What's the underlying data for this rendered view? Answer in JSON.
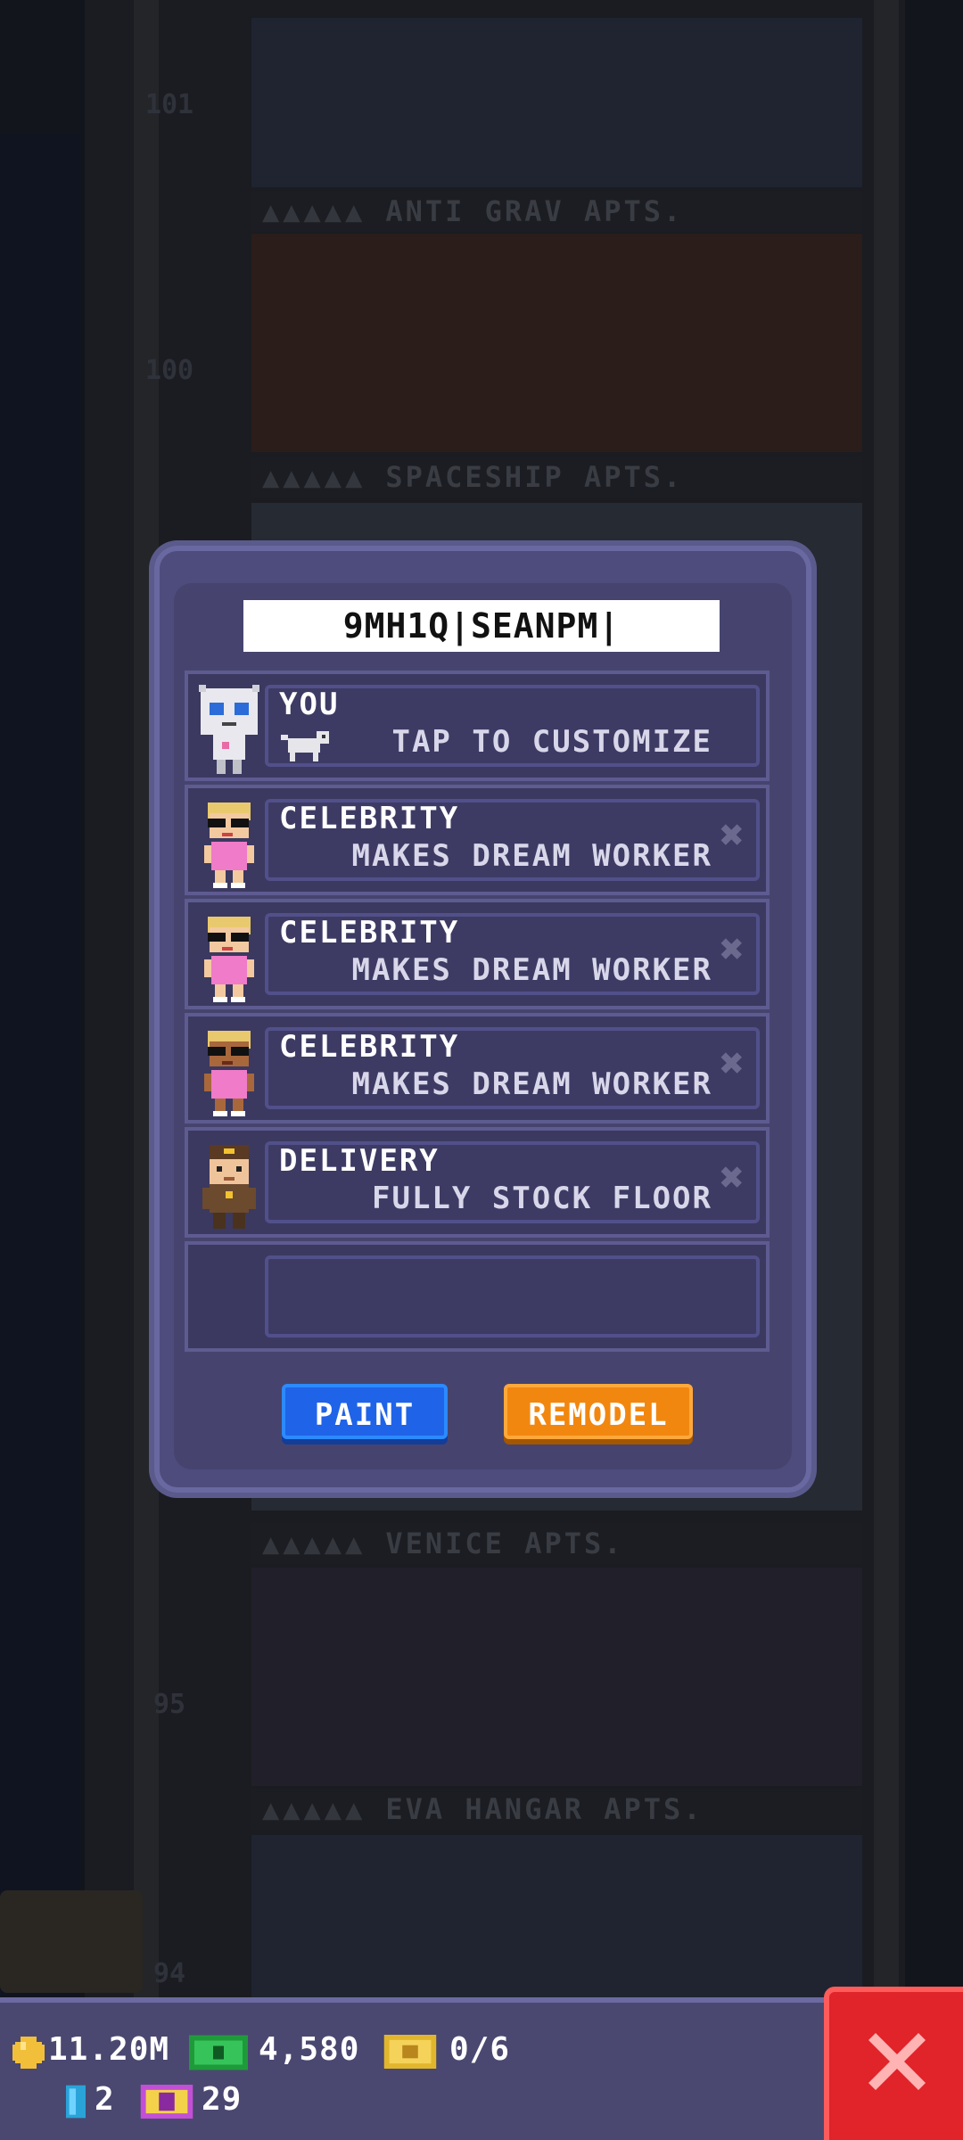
{
  "background": {
    "floor_numbers": [
      "101",
      "100",
      "95",
      "94"
    ],
    "floor_signs": [
      {
        "stars": "▲▲▲▲▲",
        "name": "ANTI GRAV APTS."
      },
      {
        "stars": "▲▲▲▲▲",
        "name": "SPACESHIP APTS."
      },
      {
        "stars": "▲▲▲▲▲",
        "name": "VENICE APTS."
      },
      {
        "stars": "▲▲▲▲▲",
        "name": "EVA HANGAR APTS."
      }
    ]
  },
  "dialog": {
    "name_field_value": "9MH1Q|SEANPM|",
    "rows": [
      {
        "title": "YOU",
        "subtitle": "TAP TO CUSTOMIZE",
        "avatar": "robot-avatar-icon",
        "removable": false
      },
      {
        "title": "CELEBRITY",
        "subtitle": "MAKES DREAM WORKER",
        "avatar": "celebrity-avatar-icon",
        "removable": true
      },
      {
        "title": "CELEBRITY",
        "subtitle": "MAKES DREAM WORKER",
        "avatar": "celebrity-avatar-icon",
        "removable": true
      },
      {
        "title": "CELEBRITY",
        "subtitle": "MAKES DREAM WORKER",
        "avatar": "celebrity-avatar-icon",
        "removable": true
      },
      {
        "title": "DELIVERY",
        "subtitle": "FULLY STOCK FLOOR",
        "avatar": "delivery-avatar-icon",
        "removable": true
      },
      {
        "title": "",
        "subtitle": "",
        "avatar": "",
        "removable": false
      }
    ],
    "paint_label": "PAINT",
    "remodel_label": "REMODEL"
  },
  "hud": {
    "coins": "11.20M",
    "bux": "4,580",
    "tickets": "0/6",
    "keys": "2",
    "vip": "29"
  },
  "colors": {
    "paint_button": "#1f63e8",
    "remodel_button": "#f2870f",
    "close_button": "#e0242a",
    "dialog_bg": "#4e4c7c"
  }
}
